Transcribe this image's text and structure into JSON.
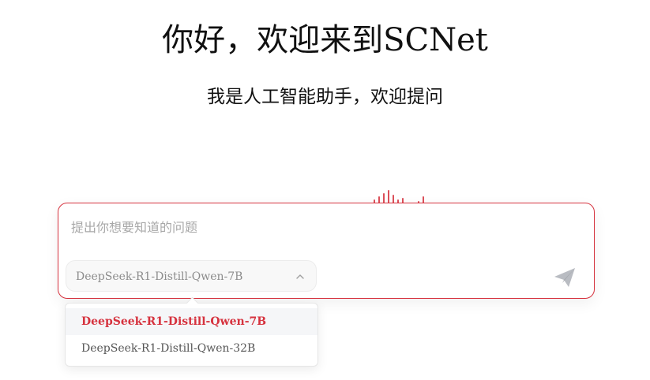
{
  "header": {
    "title": "你好，欢迎来到SCNet",
    "subtitle": "我是人工智能助手，欢迎提问"
  },
  "chat": {
    "placeholder": "提出你想要知道的问题",
    "value": ""
  },
  "model_select": {
    "selected": "DeepSeek-R1-Distill-Qwen-7B",
    "options": [
      "DeepSeek-R1-Distill-Qwen-7B",
      "DeepSeek-R1-Distill-Qwen-32B"
    ]
  },
  "colors": {
    "accent": "#d6323e",
    "send_icon": "#b9bcc2"
  },
  "icons": {
    "chevron": "chevron-up-icon",
    "send": "paper-plane-icon"
  }
}
